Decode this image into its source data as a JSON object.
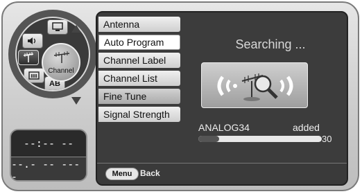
{
  "dial": {
    "center_label": "Channel",
    "ab_label": "AB",
    "segment_icons": [
      "tv-screen-icon",
      "speaker-icon",
      "antenna-icon",
      "subtitle-icon",
      "ab-icon"
    ]
  },
  "clock": {
    "time": "--:-- --",
    "date": "--.- -- ----"
  },
  "menu": {
    "items": [
      {
        "label": "Antenna"
      },
      {
        "label": "Auto Program"
      },
      {
        "label": "Channel Label"
      },
      {
        "label": "Channel List"
      },
      {
        "label": "Fine Tune"
      },
      {
        "label": "Signal Strength"
      }
    ],
    "selected": "Auto Program"
  },
  "scan": {
    "status": "Searching ...",
    "channel": "ANALOG34",
    "result": "added",
    "progress_value": 5,
    "progress_max": "30"
  },
  "footer": {
    "menu_button": "Menu",
    "back_label": "Back"
  },
  "colors": {
    "screen_bg": "#3c3c3c",
    "menu_item_bg": "#e0e0e0",
    "text_light": "#eeeeee"
  }
}
